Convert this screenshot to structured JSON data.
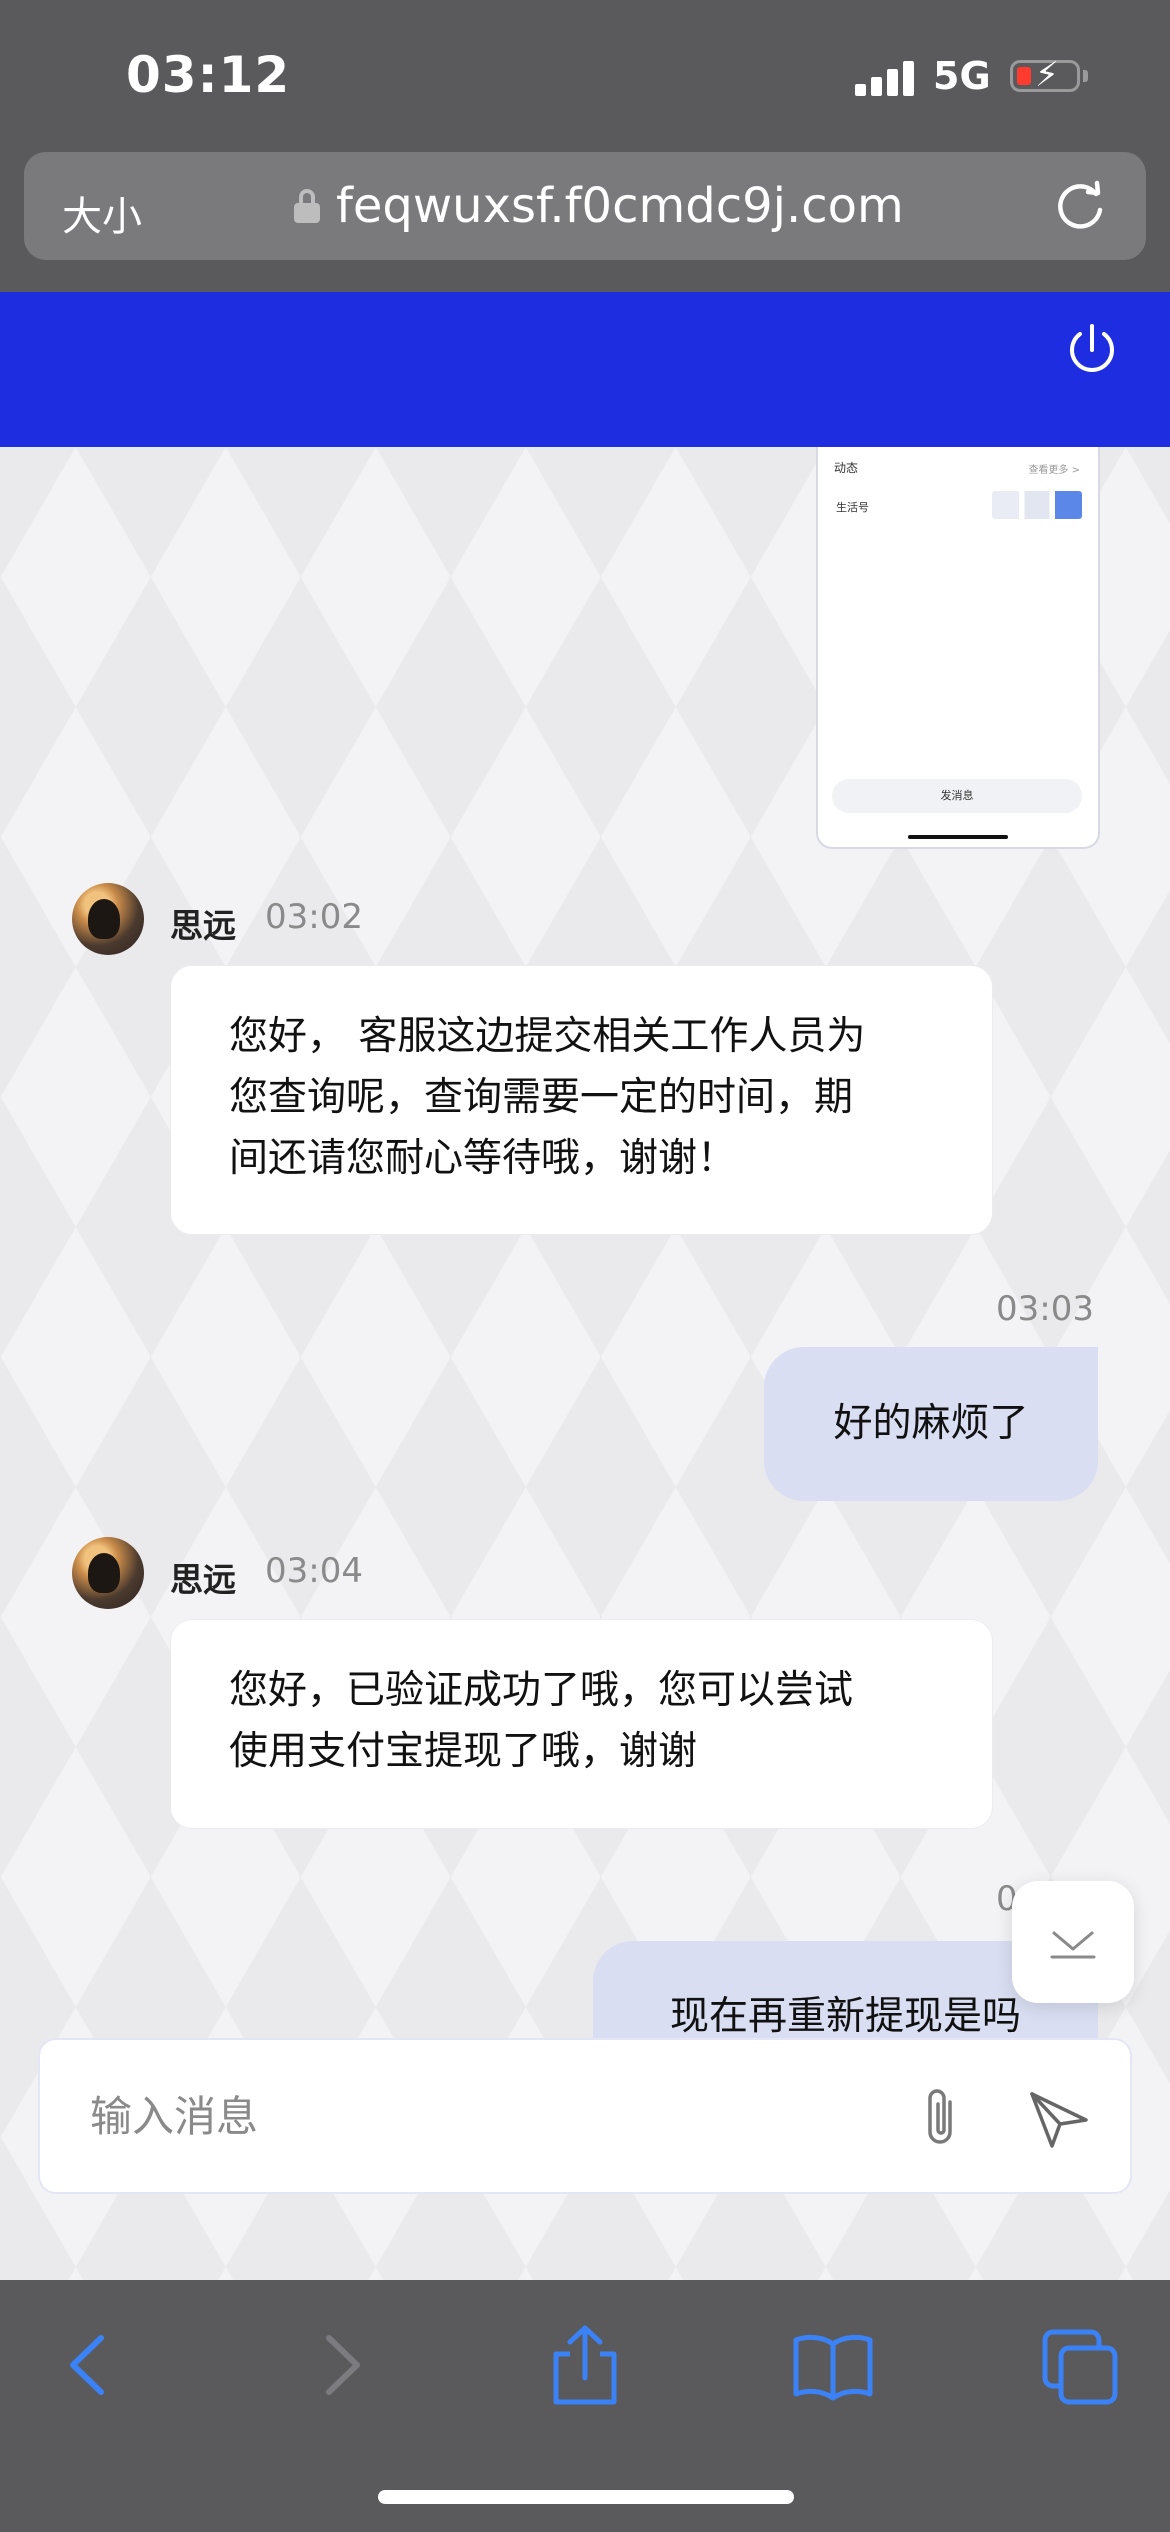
{
  "status_bar": {
    "time": "03:12",
    "network": "5G",
    "battery_charging": true,
    "battery_color": "#ff3b30"
  },
  "browser": {
    "text_size_label": "大小",
    "url": "feqwuxsf.f0cmdc9j.com",
    "lock_icon": "lock-icon",
    "reload_icon": "reload-icon"
  },
  "header": {
    "color": "#1e2de0",
    "power_icon": "power-icon"
  },
  "screenshot_preview": {
    "title": "动态",
    "more": "查看更多 >",
    "item": "生活号",
    "send_label": "发消息"
  },
  "messages": [
    {
      "side": "left",
      "sender": "思远",
      "time": "03:02",
      "lines": [
        "您好， 客服这边提交相关工作人员为",
        "您查询呢，查询需要一定的时间，期",
        "间还请您耐心等待哦，谢谢！"
      ]
    },
    {
      "side": "right",
      "time": "03:03",
      "text": "好的麻烦了"
    },
    {
      "side": "left",
      "sender": "思远",
      "time": "03:04",
      "lines": [
        "您好，已验证成功了哦，您可以尝试",
        "使用支付宝提现了哦，谢谢"
      ]
    },
    {
      "side": "right",
      "time_partial": "0",
      "text": "现在再重新提现是吗"
    }
  ],
  "input": {
    "placeholder": "输入消息",
    "value": "",
    "attach_icon": "paperclip-icon",
    "send_icon": "send-icon"
  },
  "toolbar": {
    "icons": [
      "back-icon",
      "forward-icon",
      "share-icon",
      "bookmarks-icon",
      "tabs-icon"
    ],
    "accent": "#3b82f6"
  }
}
